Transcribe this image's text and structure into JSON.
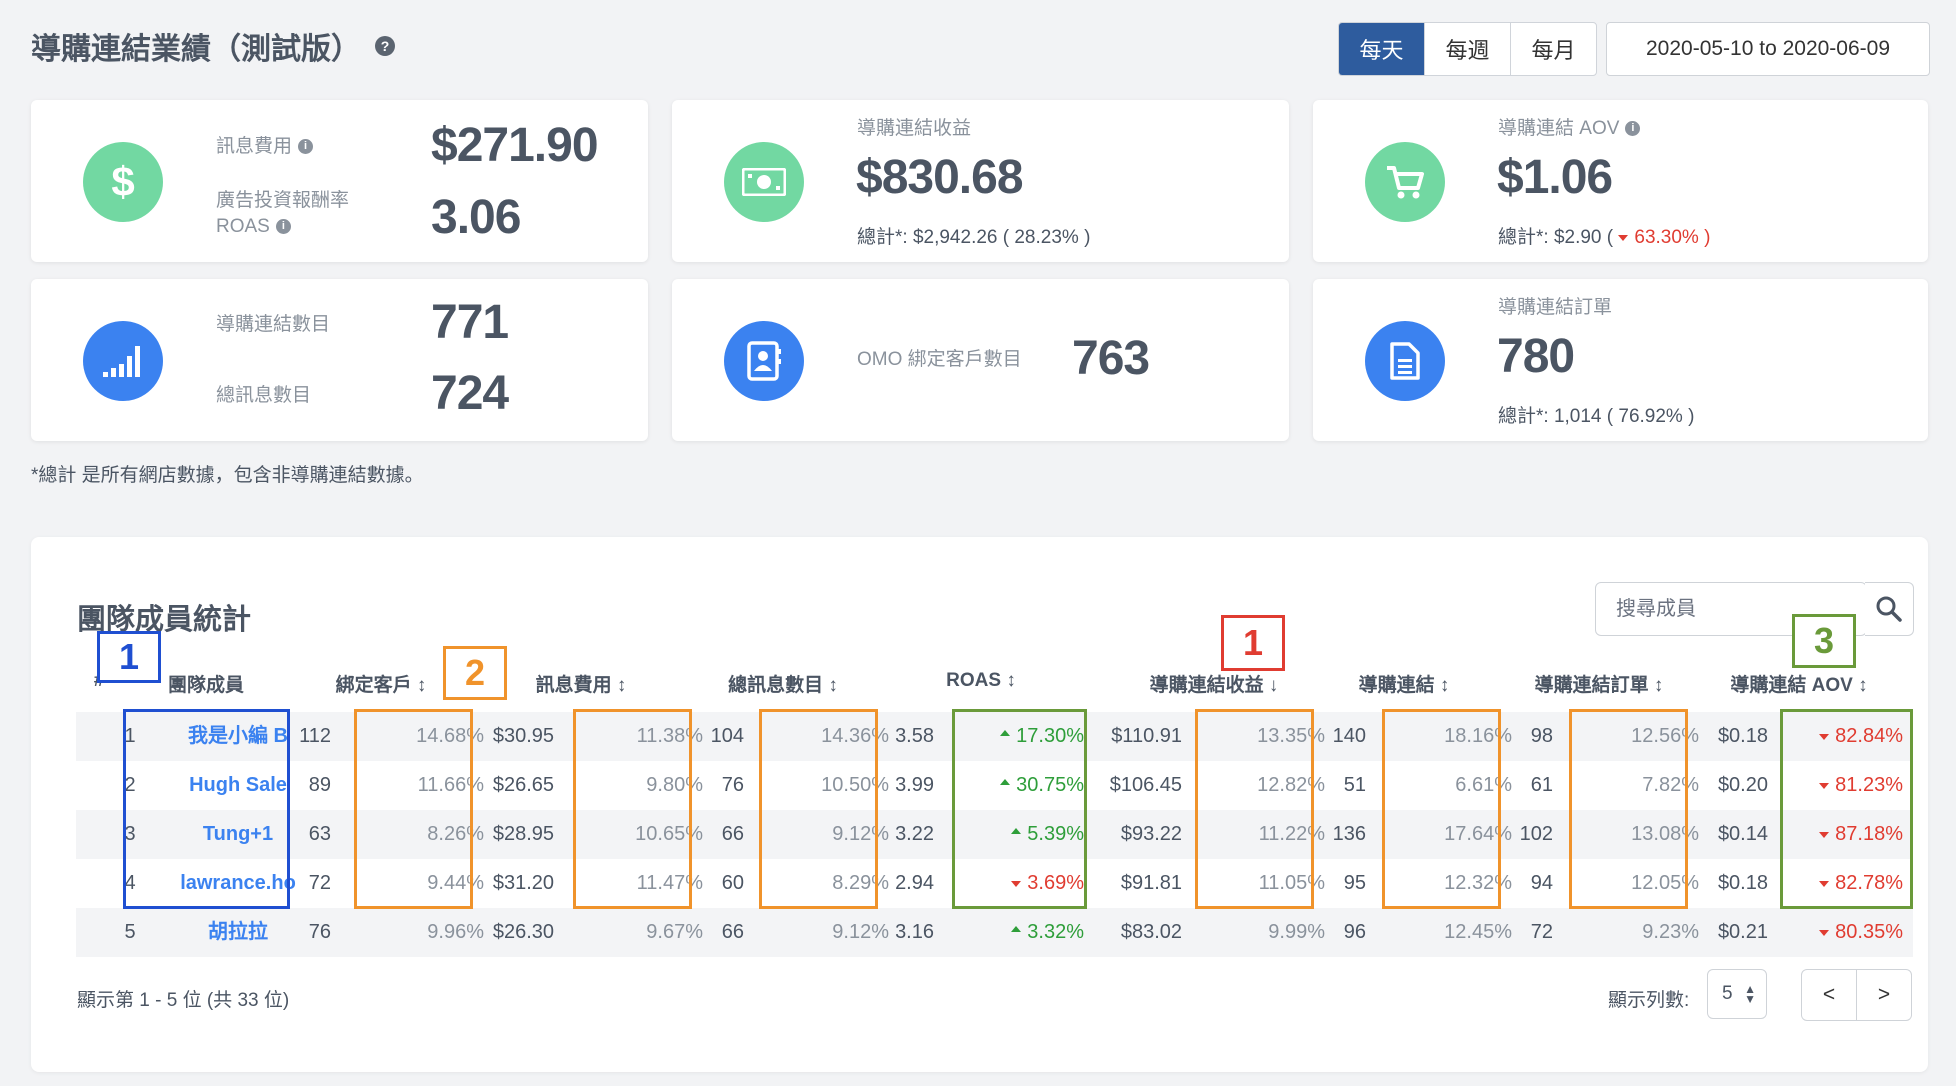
{
  "header": {
    "title": "導購連結業績（測試版）",
    "help_icon": "question-circle-icon",
    "periods": [
      "每天",
      "每週",
      "每月"
    ],
    "active_period": "每天",
    "date_range": "2020-05-10 to 2020-06-09"
  },
  "cards": {
    "message_cost": {
      "icon": "dollar-icon",
      "label": "訊息費用",
      "value": "$271.90",
      "roas_label_1": "廣告投資報酬率",
      "roas_label_2": "ROAS",
      "roas_value": "3.06"
    },
    "revenue": {
      "icon": "cash-icon",
      "label": "導購連結收益",
      "value": "$830.68",
      "sub": "總計*: $2,942.26 ( 28.23% )"
    },
    "aov": {
      "icon": "cart-icon",
      "label": "導購連結 AOV",
      "value": "$1.06",
      "sub_prefix": "總計*: $2.90 (",
      "sub_change": "63.30%",
      "sub_suffix": ")"
    },
    "links": {
      "icon": "signal-bars-icon",
      "label": "導購連結數目",
      "value": "771",
      "messages_label": "總訊息數目",
      "messages_value": "724"
    },
    "omo": {
      "icon": "contact-book-icon",
      "label": "OMO 綁定客戶數目",
      "value": "763"
    },
    "orders": {
      "icon": "document-icon",
      "label": "導購連結訂單",
      "value": "780",
      "sub": "總計*: 1,014 ( 76.92% )"
    }
  },
  "footnote": "*總計 是所有網店數據，包含非導購連結數據。",
  "team": {
    "title": "團隊成員統計",
    "search_placeholder": "搜尋成員",
    "columns": [
      "#",
      "團隊成員",
      "綁定客戶",
      "訊息費用",
      "總訊息數目",
      "ROAS",
      "導購連結收益",
      "導購連結",
      "導購連結訂單",
      "導購連結 AOV"
    ],
    "rows": [
      {
        "rank": "1",
        "name": "我是小編 B",
        "customers": "112",
        "customers_pct": "14.68%",
        "cost": "$30.95",
        "cost_pct": "11.38%",
        "messages": "104",
        "messages_pct": "14.36%",
        "roas": "3.58",
        "roas_change": "17.30%",
        "roas_dir": "up",
        "revenue": "$110.91",
        "revenue_pct": "13.35%",
        "links": "140",
        "links_pct": "18.16%",
        "orders": "98",
        "orders_pct": "12.56%",
        "aov": "$0.18",
        "aov_change": "82.84%",
        "aov_dir": "down"
      },
      {
        "rank": "2",
        "name": "Hugh Sale",
        "customers": "89",
        "customers_pct": "11.66%",
        "cost": "$26.65",
        "cost_pct": "9.80%",
        "messages": "76",
        "messages_pct": "10.50%",
        "roas": "3.99",
        "roas_change": "30.75%",
        "roas_dir": "up",
        "revenue": "$106.45",
        "revenue_pct": "12.82%",
        "links": "51",
        "links_pct": "6.61%",
        "orders": "61",
        "orders_pct": "7.82%",
        "aov": "$0.20",
        "aov_change": "81.23%",
        "aov_dir": "down"
      },
      {
        "rank": "3",
        "name": "Tung+1",
        "customers": "63",
        "customers_pct": "8.26%",
        "cost": "$28.95",
        "cost_pct": "10.65%",
        "messages": "66",
        "messages_pct": "9.12%",
        "roas": "3.22",
        "roas_change": "5.39%",
        "roas_dir": "up",
        "revenue": "$93.22",
        "revenue_pct": "11.22%",
        "links": "136",
        "links_pct": "17.64%",
        "orders": "102",
        "orders_pct": "13.08%",
        "aov": "$0.14",
        "aov_change": "87.18%",
        "aov_dir": "down"
      },
      {
        "rank": "4",
        "name": "lawrance.ho",
        "customers": "72",
        "customers_pct": "9.44%",
        "cost": "$31.20",
        "cost_pct": "11.47%",
        "messages": "60",
        "messages_pct": "8.29%",
        "roas": "2.94",
        "roas_change": "3.69%",
        "roas_dir": "down",
        "revenue": "$91.81",
        "revenue_pct": "11.05%",
        "links": "95",
        "links_pct": "12.32%",
        "orders": "94",
        "orders_pct": "12.05%",
        "aov": "$0.18",
        "aov_change": "82.78%",
        "aov_dir": "down"
      },
      {
        "rank": "5",
        "name": "胡拉拉",
        "customers": "76",
        "customers_pct": "9.96%",
        "cost": "$26.30",
        "cost_pct": "9.67%",
        "messages": "66",
        "messages_pct": "9.12%",
        "roas": "3.16",
        "roas_change": "3.32%",
        "roas_dir": "up",
        "revenue": "$83.02",
        "revenue_pct": "9.99%",
        "links": "96",
        "links_pct": "12.45%",
        "orders": "72",
        "orders_pct": "9.23%",
        "aov": "$0.21",
        "aov_change": "80.35%",
        "aov_dir": "down"
      }
    ],
    "pagination_info": "顯示第 1 - 5 位 (共 33 位)",
    "rows_per_page_label": "顯示列數:",
    "rows_per_page": "5",
    "prev_label": "<",
    "next_label": ">"
  },
  "annotations": [
    {
      "label": "1",
      "color": "#1f4fd1"
    },
    {
      "label": "2",
      "color": "#f0932b"
    },
    {
      "label": "1",
      "color": "#e03c31"
    },
    {
      "label": "3",
      "color": "#6a9a3a"
    }
  ]
}
